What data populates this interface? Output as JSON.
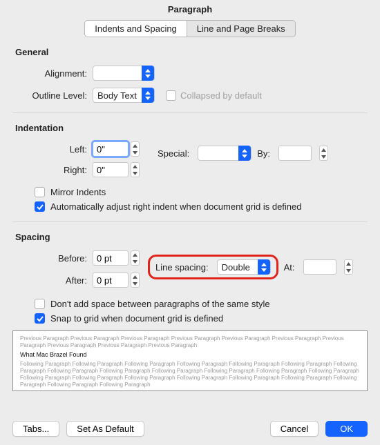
{
  "title": "Paragraph",
  "tabs": {
    "indents": "Indents and Spacing",
    "breaks": "Line and Page Breaks"
  },
  "general": {
    "heading": "General",
    "alignment_label": "Alignment:",
    "alignment_value": "",
    "outline_label": "Outline Level:",
    "outline_value": "Body Text",
    "collapsed_label": "Collapsed by default"
  },
  "indentation": {
    "heading": "Indentation",
    "left_label": "Left:",
    "left_value": "0\"",
    "right_label": "Right:",
    "right_value": "0\"",
    "special_label": "Special:",
    "special_value": "",
    "by_label": "By:",
    "by_value": "",
    "mirror_label": "Mirror Indents",
    "auto_label": "Automatically adjust right indent when document grid is defined"
  },
  "spacing": {
    "heading": "Spacing",
    "before_label": "Before:",
    "before_value": "0 pt",
    "after_label": "After:",
    "after_value": "0 pt",
    "line_label": "Line spacing:",
    "line_value": "Double",
    "at_label": "At:",
    "at_value": "",
    "nospace_label": "Don't add space between paragraphs of the same style",
    "snap_label": "Snap to grid when document grid is defined"
  },
  "preview": {
    "prev": "Previous Paragraph Previous Paragraph Previous Paragraph Previous Paragraph Previous Paragraph Previous Paragraph Previous Paragraph Previous Paragraph Previous Paragraph Previous Paragraph",
    "main": "What Mac Brazel Found",
    "next": "Following Paragraph Following Paragraph Following Paragraph Following Paragraph Following Paragraph Following Paragraph Following Paragraph Following Paragraph Following Paragraph Following Paragraph Following Paragraph Following Paragraph Following Paragraph Following Paragraph Following Paragraph Following Paragraph Following Paragraph Following Paragraph Following Paragraph Following Paragraph Following Paragraph Following Paragraph"
  },
  "buttons": {
    "tabs": "Tabs...",
    "default": "Set As Default",
    "cancel": "Cancel",
    "ok": "OK"
  }
}
